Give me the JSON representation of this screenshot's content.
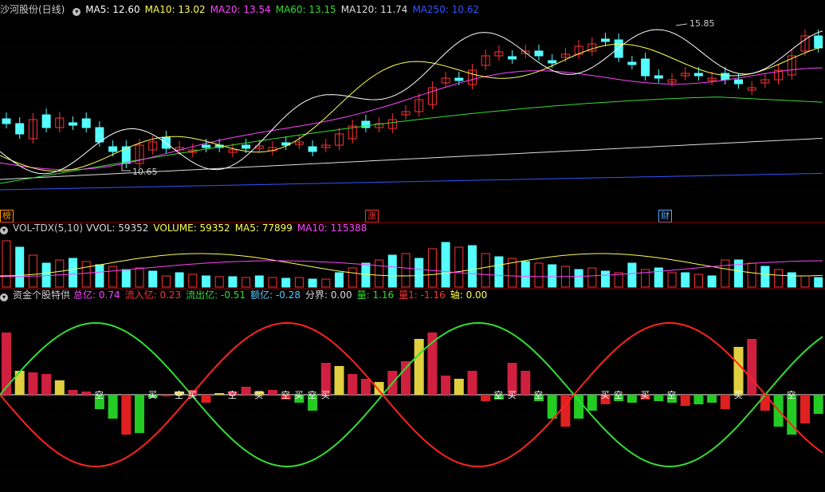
{
  "main": {
    "title": "沙河股份(日线)",
    "indicators": [
      {
        "label": "MA5: 12.60",
        "color": "#ffffff"
      },
      {
        "label": "MA10: 13.02",
        "color": "#ffff55"
      },
      {
        "label": "MA20: 13.54",
        "color": "#ff44ff"
      },
      {
        "label": "MA60: 13.15",
        "color": "#33dd33"
      },
      {
        "label": "MA120: 11.74",
        "color": "#dddddd"
      },
      {
        "label": "MA250: 10.62",
        "color": "#3355ff"
      }
    ],
    "high_label": "15.85",
    "low_label": "10.65",
    "badges": [
      {
        "text": "榜",
        "color": "#ff9900"
      },
      {
        "text": "涨",
        "color": "#ff3333"
      },
      {
        "text": "财",
        "color": "#55aaff"
      }
    ]
  },
  "volume": {
    "title": "VOL-TDX(5,10)",
    "indicators": [
      {
        "label": "VVOL: 59352",
        "color": "#dddddd"
      },
      {
        "label": "VOLUME: 59352",
        "color": "#ffff55"
      },
      {
        "label": "MA5: 77899",
        "color": "#ffff55"
      },
      {
        "label": "MA10: 115388",
        "color": "#ff44ff"
      }
    ]
  },
  "fund": {
    "title": "资金个股特供",
    "indicators": [
      {
        "label": "总亿: 0.74",
        "color": "#ff44ff"
      },
      {
        "label": "流入亿: 0.23",
        "color": "#ff3333"
      },
      {
        "label": "流出亿: -0.51",
        "color": "#33dd33"
      },
      {
        "label": "额亿: -0.28",
        "color": "#55ccff"
      },
      {
        "label": "分界: 0.00",
        "color": "#dddddd"
      },
      {
        "label": "量: 1.16",
        "color": "#33dd33"
      },
      {
        "label": "量1: -1.16",
        "color": "#ff3333"
      },
      {
        "label": "轴: 0.00",
        "color": "#ffff55"
      }
    ],
    "signals": [
      {
        "text": "空",
        "i": 7
      },
      {
        "text": "买",
        "i": 11
      },
      {
        "text": "空",
        "i": 13
      },
      {
        "text": "买",
        "i": 14
      },
      {
        "text": "空",
        "i": 17
      },
      {
        "text": "买",
        "i": 19
      },
      {
        "text": "空",
        "i": 21
      },
      {
        "text": "买",
        "i": 22
      },
      {
        "text": "空",
        "i": 23
      },
      {
        "text": "买",
        "i": 24
      },
      {
        "text": "空",
        "i": 37
      },
      {
        "text": "买",
        "i": 38
      },
      {
        "text": "空",
        "i": 40
      },
      {
        "text": "买",
        "i": 45
      },
      {
        "text": "空",
        "i": 46
      },
      {
        "text": "买",
        "i": 48
      },
      {
        "text": "空",
        "i": 50
      },
      {
        "text": "买",
        "i": 55
      },
      {
        "text": "空",
        "i": 59
      }
    ]
  },
  "colors": {
    "up": "#ff3333",
    "down": "#55ffff",
    "grid": "#8b0000"
  }
}
